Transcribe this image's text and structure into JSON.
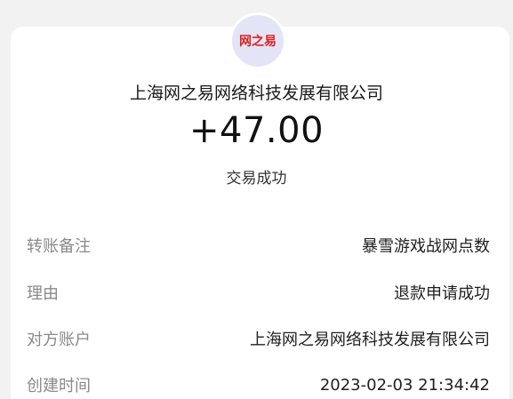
{
  "header": {
    "logo_text": "网之易",
    "merchant_name": "上海网之易网络科技发展有限公司",
    "amount": "+47.00",
    "status": "交易成功"
  },
  "details": [
    {
      "label": "转账备注",
      "value": "暴雪游戏战网点数"
    },
    {
      "label": "理由",
      "value": "退款申请成功"
    },
    {
      "label": "对方账户",
      "value": "上海网之易网络科技发展有限公司"
    },
    {
      "label": "创建时间",
      "value": "2023-02-03 21:34:42"
    }
  ],
  "colors": {
    "background": "#f2f2f2",
    "card": "#ffffff",
    "logo_bg": "#e3e5f7",
    "logo_text": "#e02020",
    "label": "#8a8a8a"
  }
}
